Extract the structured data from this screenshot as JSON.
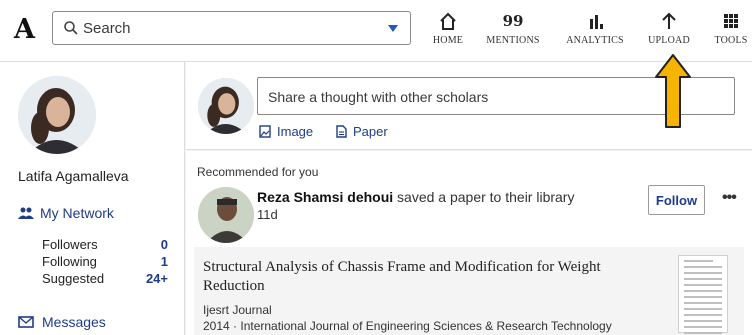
{
  "header": {
    "logo": "A",
    "search_placeholder": "Search",
    "nav": [
      {
        "label": "HOME",
        "icon": "home-icon"
      },
      {
        "label": "MENTIONS",
        "icon": "quote-icon",
        "glyph": "99"
      },
      {
        "label": "ANALYTICS",
        "icon": "bar-chart-icon"
      },
      {
        "label": "UPLOAD",
        "icon": "upload-arrow-icon"
      },
      {
        "label": "TOOLS",
        "icon": "grid-icon"
      }
    ]
  },
  "profile": {
    "name": "Latifa Agamalleva",
    "network_label": "My Network",
    "stats": [
      {
        "label": "Followers",
        "value": "0"
      },
      {
        "label": "Following",
        "value": "1"
      },
      {
        "label": "Suggested",
        "value": "24+"
      }
    ],
    "messages_label": "Messages"
  },
  "composer": {
    "placeholder": "Share a thought with other scholars",
    "image_label": "Image",
    "paper_label": "Paper"
  },
  "feed": {
    "section_label": "Recommended for you",
    "actor": "Reza Shamsi dehoui",
    "action": "saved a paper to their library",
    "time": "11d",
    "follow_label": "Follow",
    "more_label": "•••",
    "paper": {
      "title": "Structural Analysis of Chassis Frame and Modification for Weight Reduction",
      "journal": "Ijesrt Journal",
      "meta": "2014 · International Journal of Engineering Sciences & Research Technology"
    }
  },
  "colors": {
    "link": "#1f3c88",
    "annotation_arrow": "#f5b400"
  }
}
